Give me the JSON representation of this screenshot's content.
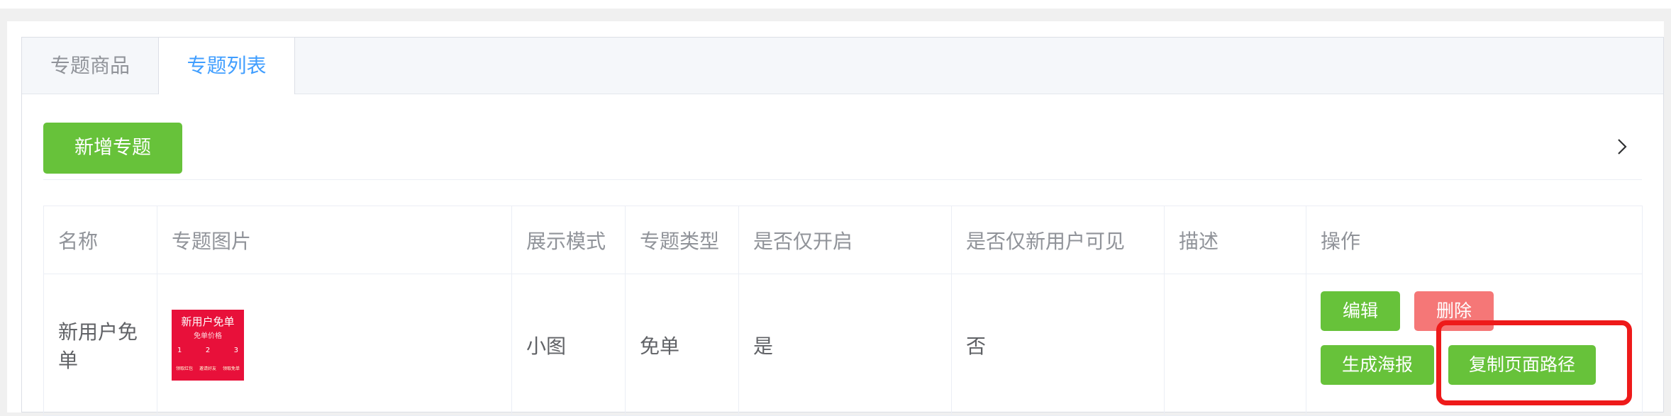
{
  "tabs": [
    {
      "label": "专题商品",
      "active": false
    },
    {
      "label": "专题列表",
      "active": true
    }
  ],
  "toolbar": {
    "add_label": "新增专题",
    "expand_icon": "chevron-right-icon"
  },
  "table": {
    "headers": [
      "名称",
      "专题图片",
      "展示模式",
      "专题类型",
      "是否仅开启",
      "是否仅新用户可见",
      "描述",
      "操作"
    ],
    "rows": [
      {
        "name": "新用户免单",
        "image": {
          "title": "新用户免单",
          "subtitle": "免单价格",
          "steps": [
            "1",
            "2",
            "3"
          ],
          "footer": [
            "领取红包",
            "邀请好友",
            "领取免单"
          ]
        },
        "display_mode": "小图",
        "topic_type": "免单",
        "only_open": "是",
        "new_user_only": "否",
        "description": "",
        "actions": {
          "edit": "编辑",
          "delete": "删除",
          "poster": "生成海报",
          "copy_path": "复制页面路径"
        }
      }
    ]
  },
  "colors": {
    "primary": "#409eff",
    "success": "#67c23a",
    "danger": "#f56c6c",
    "highlight": "#ee1a1a"
  }
}
